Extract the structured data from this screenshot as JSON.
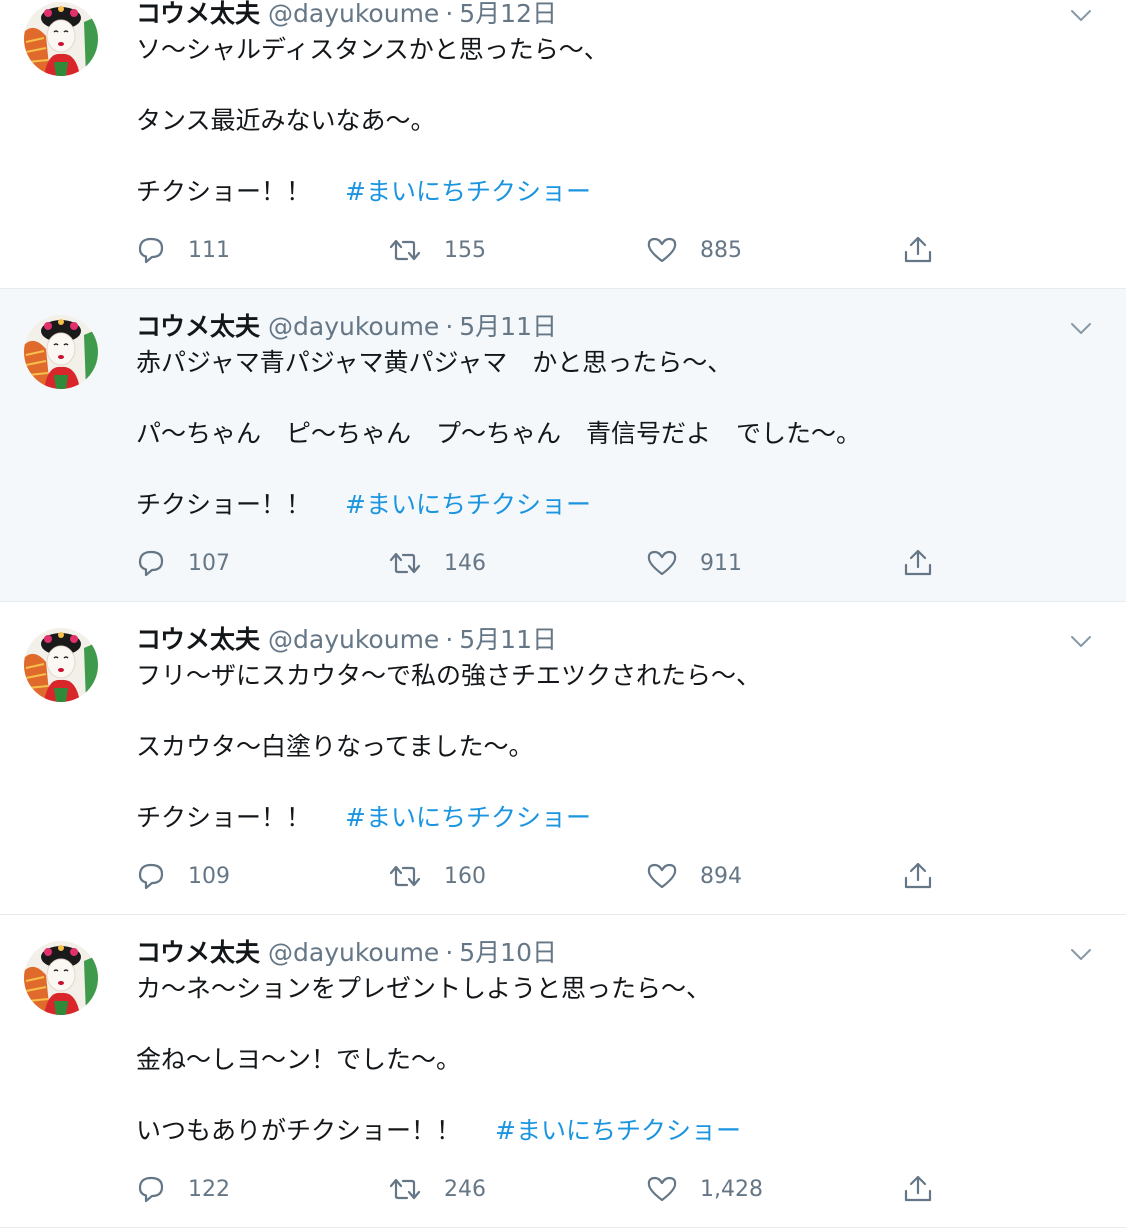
{
  "tweets": [
    {
      "name": "コウメ太夫",
      "handle": "@dayukoume",
      "sep": "·",
      "date": "5月12日",
      "line1": "ソ〜シャルディスタンスかと思ったら〜、",
      "line2": "タンス最近みないなあ〜。",
      "line3": "チクショー！！",
      "hashtag": "#まいにちチクショー",
      "replies": "111",
      "retweets": "155",
      "likes": "885"
    },
    {
      "name": "コウメ太夫",
      "handle": "@dayukoume",
      "sep": "·",
      "date": "5月11日",
      "line1": "赤パジャマ青パジャマ黄パジャマ　かと思ったら〜、",
      "line2": "パ〜ちゃん　ピ〜ちゃん　プ〜ちゃん　青信号だよ　でした〜。",
      "line3": "チクショー！！",
      "hashtag": "#まいにちチクショー",
      "replies": "107",
      "retweets": "146",
      "likes": "911"
    },
    {
      "name": "コウメ太夫",
      "handle": "@dayukoume",
      "sep": "·",
      "date": "5月11日",
      "line1": "フリ〜ザにスカウタ〜で私の強さチエツクされたら〜、",
      "line2": "スカウタ〜白塗りなってました〜。",
      "line3": "チクショー！！",
      "hashtag": "#まいにちチクショー",
      "replies": "109",
      "retweets": "160",
      "likes": "894"
    },
    {
      "name": "コウメ太夫",
      "handle": "@dayukoume",
      "sep": "·",
      "date": "5月10日",
      "line1": "カ〜ネ〜ションをプレゼントしようと思ったら〜、",
      "line2": "金ね〜しヨ〜ン！でした〜。",
      "line3": "いつもありがチクショー！！",
      "hashtag": "#まいにちチクショー",
      "replies": "122",
      "retweets": "246",
      "likes": "1,428"
    }
  ],
  "colors": {
    "text": "#14171a",
    "secondary": "#657786",
    "link": "#1b95e0",
    "hover_bg": "#f5f8fa",
    "divider": "#e6ecf0"
  },
  "icons": [
    "reply-icon",
    "retweet-icon",
    "like-icon",
    "share-icon",
    "chevron-down-icon"
  ]
}
